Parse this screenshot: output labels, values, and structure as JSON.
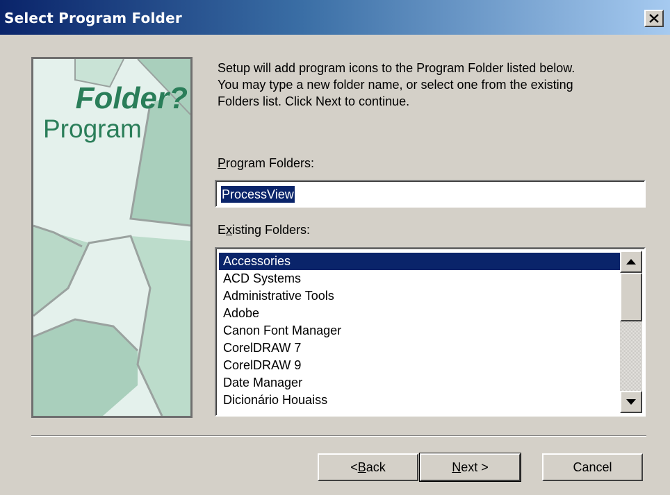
{
  "window": {
    "title": "Select Program Folder"
  },
  "banner": {
    "word_top": "Folder?",
    "word_bottom": "Program"
  },
  "intro": {
    "lines": [
      "Setup will add program icons to the Program Folder listed below.",
      "You may type a new folder name, or select one from the existing",
      "Folders list.  Click Next to continue."
    ]
  },
  "program_folders": {
    "label_mnemonic": "P",
    "label_rest": "rogram Folders:",
    "value": "ProcessView"
  },
  "existing_folders": {
    "label_first": "E",
    "label_mnemonic": "x",
    "label_rest": "isting Folders:",
    "items": [
      "Accessories",
      "ACD Systems",
      "Administrative Tools",
      "Adobe",
      "Canon Font Manager",
      "CorelDRAW 7",
      "CorelDRAW 9",
      "Date Manager",
      "Dicionário Houaiss"
    ],
    "selected": "Accessories"
  },
  "buttons": {
    "back": {
      "prefix": "< ",
      "mnemonic": "B",
      "rest": "ack"
    },
    "next": {
      "mnemonic": "N",
      "rest": "ext >"
    },
    "cancel": "Cancel"
  }
}
